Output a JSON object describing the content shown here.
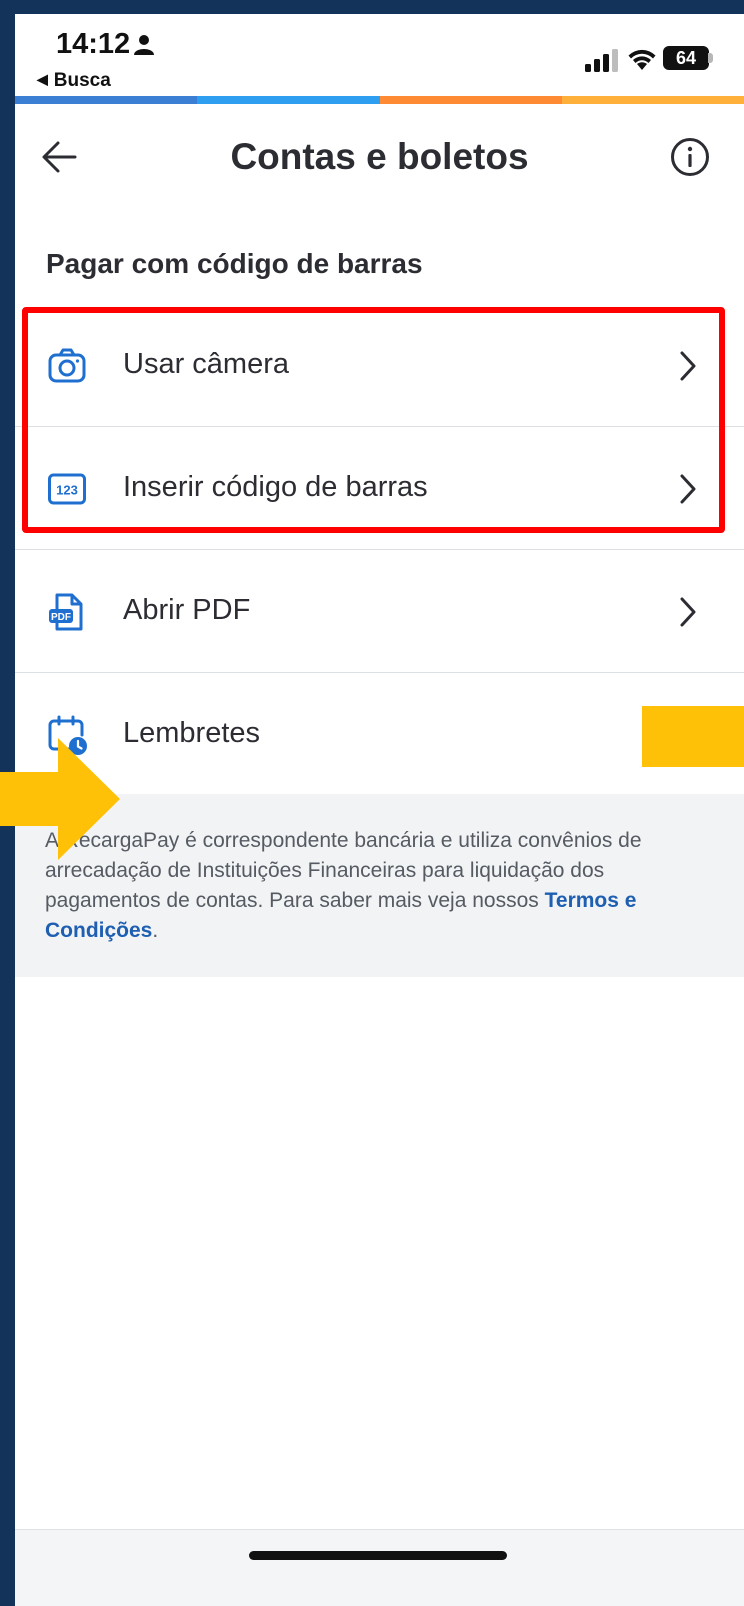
{
  "status_bar": {
    "time": "14:12",
    "back_app": "Busca",
    "battery": "64"
  },
  "progress_colors": [
    "#3a7fd4",
    "#2e9ef0",
    "#ff8a34",
    "#ffb03a"
  ],
  "header": {
    "title": "Contas e boletos"
  },
  "section": {
    "title": "Pagar com código de barras"
  },
  "list": [
    {
      "label": "Usar câmera",
      "icon": "camera-icon"
    },
    {
      "label": "Inserir código de barras",
      "icon": "barcode-123-icon",
      "icon_text": "123"
    },
    {
      "label": "Abrir PDF",
      "icon": "pdf-file-icon",
      "icon_text": "PDF"
    },
    {
      "label": "Lembretes",
      "icon": "calendar-clock-icon"
    }
  ],
  "disclaimer": {
    "text_start": "A RecargaPay é correspondente bancária e utiliza convênios de arrecadação de Instituições Financeiras para liquidação dos pagamentos de contas. Para saber mais veja nossos ",
    "link": "Termos e Condições",
    "text_end": "."
  },
  "colors": {
    "accent_blue": "#1f6fd1",
    "highlight_red": "#ff0000",
    "overlay_yellow": "#ffc107"
  }
}
